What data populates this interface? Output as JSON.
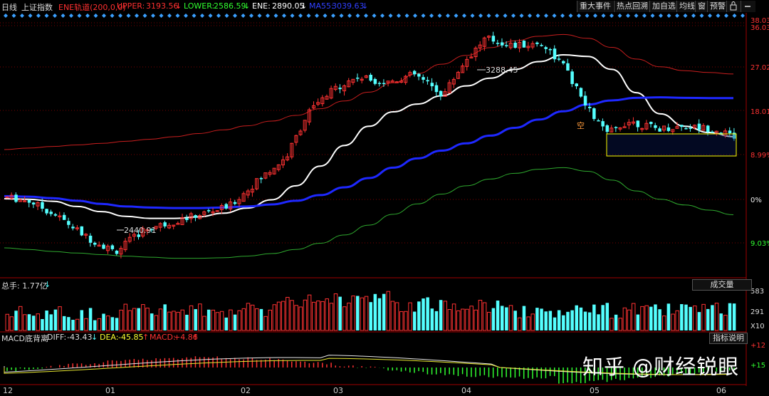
{
  "header": {
    "period": "日线",
    "symbol": "上证指数",
    "ene_label": "ENE轨道(200,0,0)",
    "upper_label": "UPPER:",
    "upper_value": "3193.56",
    "lower_label": "LOWER:",
    "lower_value": "2586.59",
    "ene_value_label": "ENE:",
    "ene_value": "2890.05",
    "ma_label": "MA55:",
    "ma_value": "3039.63",
    "arrow_down": "↓"
  },
  "toolbar": {
    "major_events": "重大事件",
    "hot_replay": "热点回溯",
    "add_watch": "加自选",
    "avg_line": "均线",
    "window": "窗",
    "alert": "预警",
    "lock_icon": "lock-icon",
    "minus_icon": "minus-icon"
  },
  "colors": {
    "up": "#ff3232",
    "down": "#54ffff",
    "upper": "#c81e1e",
    "lower": "#2ea82e",
    "ene": "#ffffff",
    "ma55": "#1e28ff",
    "grid": "#7a0000",
    "highlight": "#ffff00"
  },
  "price_axis": [
    "38.03%",
    "36.03",
    "27.02",
    "18.01",
    "8.99%",
    "0%",
    "9.03%"
  ],
  "annotations": {
    "high": "3288.45",
    "low": "2440.91",
    "kong": "空"
  },
  "volume": {
    "label": "总手: 1.77亿",
    "button": "成交量",
    "axis": [
      "583",
      "291",
      "X10"
    ]
  },
  "macd": {
    "name": "MACD底背离",
    "diff_label": "DIFF:",
    "diff_value": "-43.43",
    "dea_label": "DEA:",
    "dea_value": "-45.85",
    "macd_label": "MACD:",
    "macd_value": "+4.86",
    "button": "指标说明",
    "axis": [
      "+12",
      "+15"
    ]
  },
  "x_axis": [
    "12",
    "01",
    "02",
    "03",
    "04",
    "05",
    "06"
  ],
  "watermark": "知乎 @财经锐眼",
  "chart_data": {
    "type": "candlestick",
    "series": [
      {
        "name": "UPPER",
        "values": [
          2840,
          2846,
          2852,
          2858,
          2864,
          2872,
          2880,
          2890,
          2902,
          2916,
          2932,
          2950,
          2972,
          2998,
          3028,
          3062,
          3098,
          3134,
          3170,
          3204,
          3234,
          3260,
          3278,
          3285,
          3270,
          3235,
          3190,
          3160,
          3145,
          3138,
          3132
        ]
      },
      {
        "name": "LOWER",
        "values": [
          2460,
          2454,
          2446,
          2440,
          2434,
          2428,
          2424,
          2420,
          2420,
          2422,
          2428,
          2438,
          2454,
          2478,
          2510,
          2548,
          2590,
          2630,
          2668,
          2700,
          2726,
          2748,
          2764,
          2770,
          2756,
          2722,
          2680,
          2648,
          2626,
          2606,
          2588
        ]
      },
      {
        "name": "ENE",
        "values": [
          2650,
          2648,
          2640,
          2620,
          2600,
          2582,
          2574,
          2574,
          2580,
          2594,
          2614,
          2646,
          2700,
          2776,
          2856,
          2930,
          2986,
          3016,
          3048,
          3086,
          3116,
          3150,
          3180,
          3206,
          3200,
          3150,
          3060,
          2978,
          2930,
          2906,
          2890
        ]
      },
      {
        "name": "MA55",
        "values": [
          2660,
          2658,
          2652,
          2642,
          2630,
          2620,
          2616,
          2614,
          2614,
          2616,
          2620,
          2628,
          2642,
          2664,
          2694,
          2730,
          2770,
          2806,
          2836,
          2864,
          2894,
          2924,
          2956,
          2988,
          3014,
          3030,
          3040,
          3042,
          3040,
          3039,
          3039
        ]
      }
    ]
  }
}
